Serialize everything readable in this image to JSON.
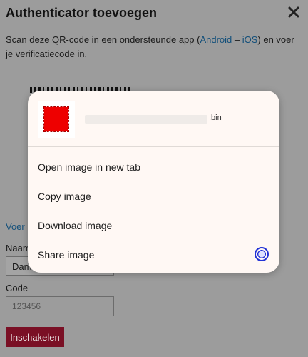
{
  "dialog": {
    "title": "Authenticator toevoegen",
    "intro_before": "Scan deze QR-code in een ondersteunde app (",
    "link_android": "Android",
    "separator": " – ",
    "link_ios": "iOS",
    "intro_after": ") en voer je verificatiecode in.",
    "manual_link": "Voer h",
    "name_label": "Naam",
    "name_value": "Dam",
    "code_label": "Code",
    "code_placeholder": "123456",
    "enable_button": "Inschakelen"
  },
  "context_menu": {
    "file_extension": ".bin",
    "items": [
      {
        "label": "Open image in new tab"
      },
      {
        "label": "Copy image"
      },
      {
        "label": "Download image"
      },
      {
        "label": "Share image"
      }
    ]
  },
  "colors": {
    "scrim": "#9c9c9c",
    "menu_background": "#fff8f4",
    "link": "#124f7a",
    "enable_button": "#7a1025",
    "share_icon": "#2233d6",
    "thumbnail": "#ee0000"
  }
}
